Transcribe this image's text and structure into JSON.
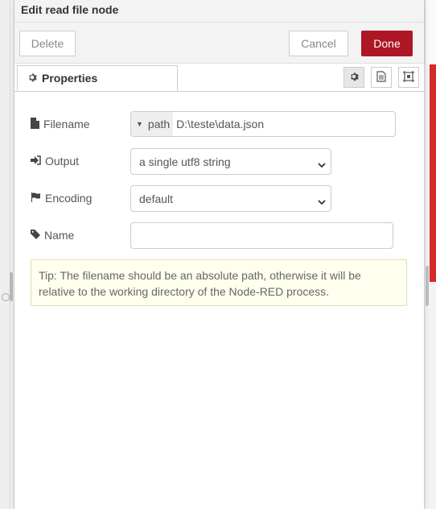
{
  "header": {
    "title": "Edit read file node"
  },
  "toolbar": {
    "delete_label": "Delete",
    "cancel_label": "Cancel",
    "done_label": "Done",
    "done_color": "#ad1625"
  },
  "tabs": {
    "properties_label": "Properties"
  },
  "form": {
    "filename": {
      "label": "Filename",
      "type_label": "path",
      "value": "D:\\teste\\data.json"
    },
    "output": {
      "label": "Output",
      "value": "a single utf8 string"
    },
    "encoding": {
      "label": "Encoding",
      "value": "default"
    },
    "name": {
      "label": "Name",
      "value": ""
    }
  },
  "tip": {
    "text": "Tip: The filename should be an absolute path, otherwise it will be relative to the working directory of the Node-RED process."
  },
  "icons": [
    "gear-icon",
    "file-icon",
    "sign-in-icon",
    "flag-icon",
    "tag-icon",
    "description-icon",
    "appearance-icon",
    "caret-down-icon",
    "chevron-down-icon"
  ]
}
